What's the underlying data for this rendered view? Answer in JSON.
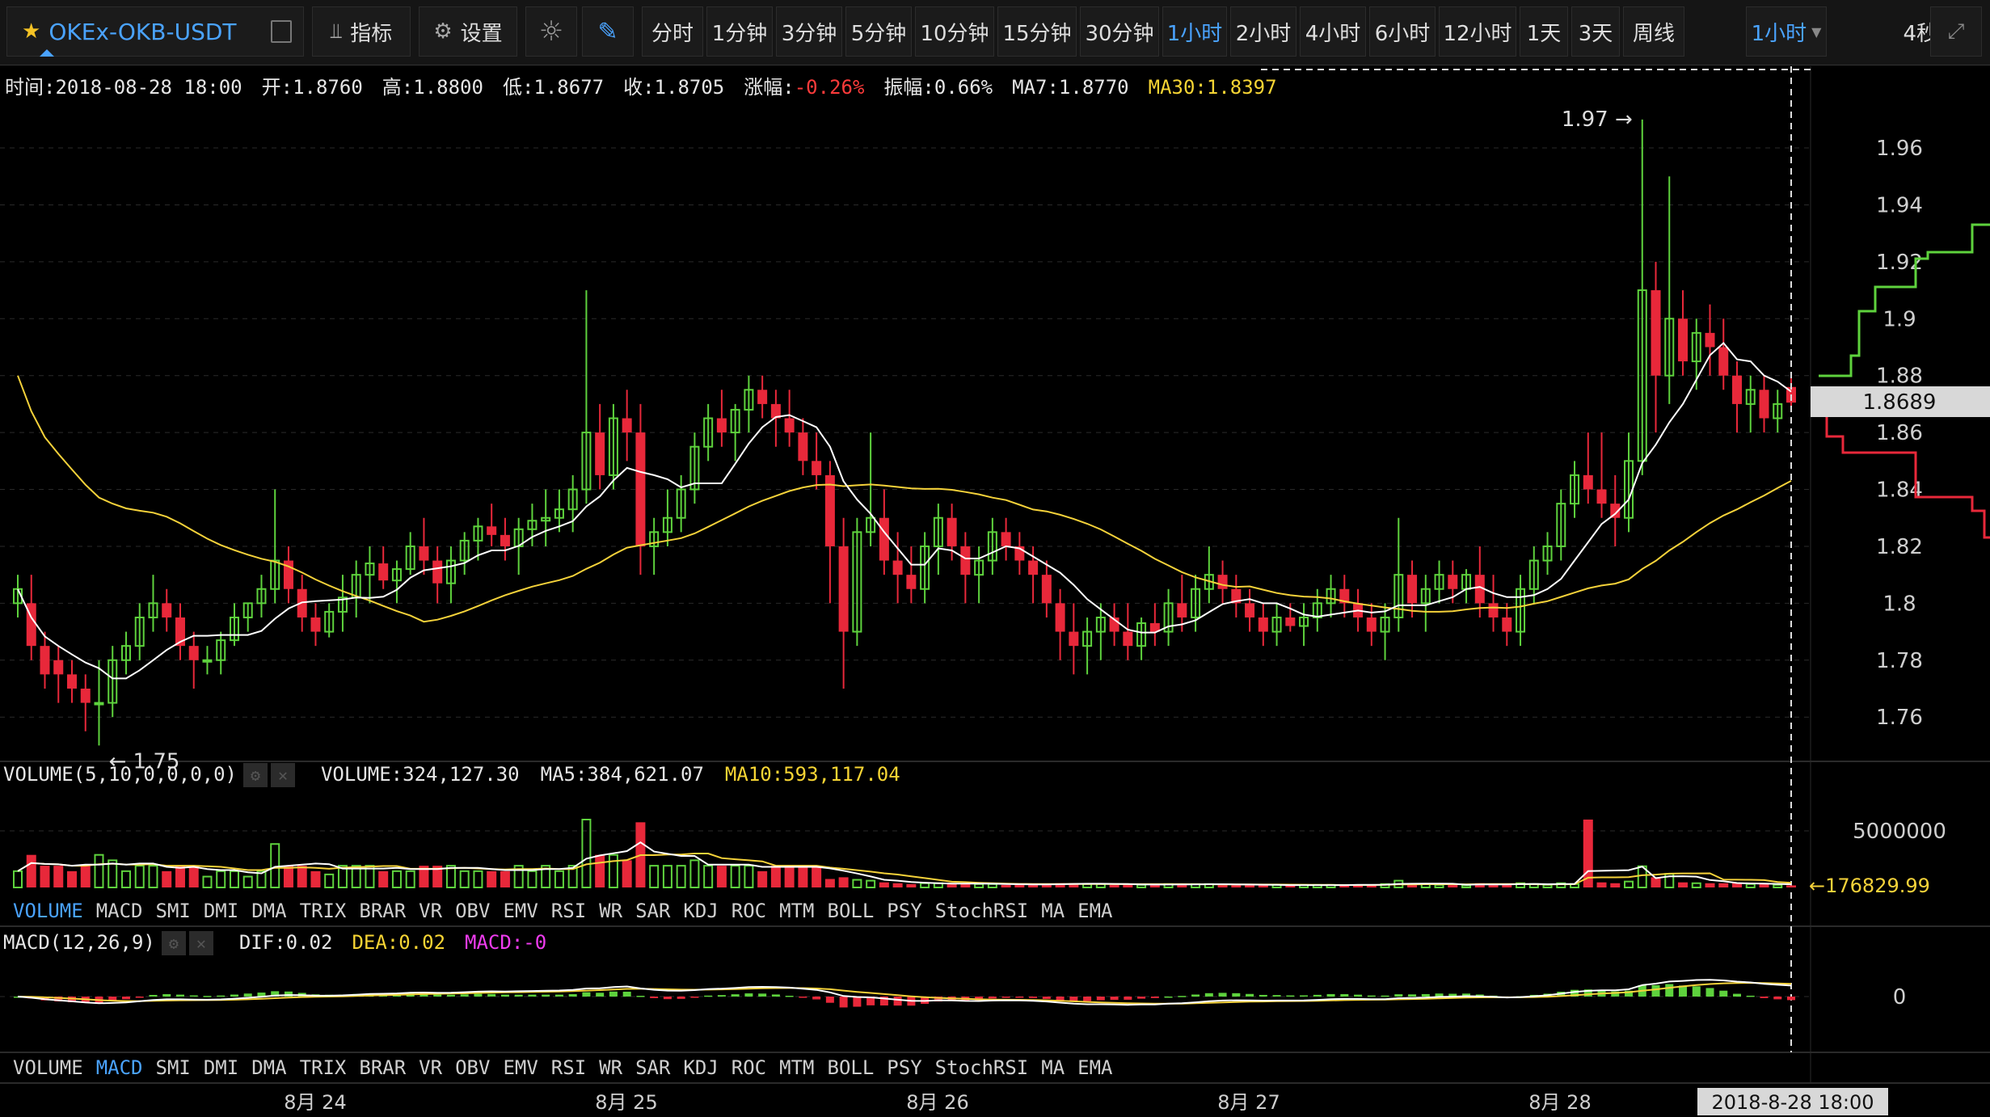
{
  "toolbar": {
    "pair": "OKEx-OKB-USDT",
    "indicators_label": "指标",
    "settings_label": "设置",
    "timeframes": [
      "分时",
      "1分钟",
      "3分钟",
      "5分钟",
      "10分钟",
      "15分钟",
      "30分钟",
      "1小时",
      "2小时",
      "4小时",
      "6小时",
      "12小时",
      "1天",
      "3天",
      "周线"
    ],
    "active_timeframe": "1小时",
    "dropdown": "1小时",
    "refresh": "4秒"
  },
  "infobar": {
    "time": "时间:2018-08-28 18:00",
    "open": "开:1.8760",
    "high": "高:1.8800",
    "low": "低:1.8677",
    "close": "收:1.8705",
    "change_label": "涨幅:",
    "change": "-0.26%",
    "amplitude": "振幅:0.66%",
    "ma7": "MA7:1.8770",
    "ma30": "MA30:1.8397"
  },
  "volume_panel": {
    "title": "VOLUME(5,10,0,0,0,0)",
    "volume": "VOLUME:324,127.30",
    "ma5": "MA5:384,621.07",
    "ma10": "MA10:593,117.04",
    "axis_label": "5000000",
    "last_marker": "←176829.99"
  },
  "macd_panel": {
    "title": "MACD(12,26,9)",
    "dif": "DIF:0.02",
    "dea": "DEA:0.02",
    "macd": "MACD:-0",
    "axis_label": "0"
  },
  "tabs": [
    "VOLUME",
    "MACD",
    "SMI",
    "DMI",
    "DMA",
    "TRIX",
    "BRAR",
    "VR",
    "OBV",
    "EMV",
    "RSI",
    "WR",
    "SAR",
    "KDJ",
    "ROC",
    "MTM",
    "BOLL",
    "PSY",
    "StochRSI",
    "MA",
    "EMA"
  ],
  "tabs_active_1": "VOLUME",
  "tabs_active_2": "MACD",
  "x_labels": [
    "8月 24",
    "8月 25",
    "8月 26",
    "8月 27",
    "8月 28"
  ],
  "crosshair_time": "2018-8-28 18:00",
  "current_price": "1.8689",
  "colors": {
    "up": "#5ed23d",
    "down": "#e8283a",
    "ma7": "#ffffff",
    "ma30": "#f5d23a",
    "accent": "#4aa3ff"
  },
  "chart_data": {
    "type": "candlestick",
    "title": "OKEx-OKB-USDT",
    "interval": "1小时",
    "y_ticks": [
      1.76,
      1.78,
      1.8,
      1.82,
      1.84,
      1.86,
      1.88,
      1.9,
      1.92,
      1.94,
      1.96
    ],
    "ylim": [
      1.745,
      1.985
    ],
    "max_label": "1.97 →",
    "min_label": "← 1.75",
    "grid": true,
    "candles_ohlc": [
      [
        1.8,
        1.81,
        1.795,
        1.805
      ],
      [
        1.8,
        1.81,
        1.78,
        1.785
      ],
      [
        1.785,
        1.79,
        1.77,
        1.775
      ],
      [
        1.78,
        1.785,
        1.765,
        1.775
      ],
      [
        1.775,
        1.78,
        1.765,
        1.77
      ],
      [
        1.77,
        1.775,
        1.755,
        1.765
      ],
      [
        1.765,
        1.78,
        1.75,
        1.765
      ],
      [
        1.765,
        1.785,
        1.76,
        1.78
      ],
      [
        1.78,
        1.79,
        1.775,
        1.785
      ],
      [
        1.785,
        1.8,
        1.78,
        1.795
      ],
      [
        1.795,
        1.81,
        1.79,
        1.8
      ],
      [
        1.8,
        1.805,
        1.79,
        1.795
      ],
      [
        1.795,
        1.8,
        1.78,
        1.785
      ],
      [
        1.785,
        1.79,
        1.77,
        1.78
      ],
      [
        1.78,
        1.785,
        1.775,
        1.78
      ],
      [
        1.78,
        1.79,
        1.775,
        1.787
      ],
      [
        1.787,
        1.8,
        1.785,
        1.795
      ],
      [
        1.795,
        1.8,
        1.79,
        1.8
      ],
      [
        1.8,
        1.81,
        1.795,
        1.805
      ],
      [
        1.805,
        1.84,
        1.8,
        1.815
      ],
      [
        1.815,
        1.82,
        1.8,
        1.805
      ],
      [
        1.805,
        1.81,
        1.79,
        1.795
      ],
      [
        1.795,
        1.8,
        1.785,
        1.79
      ],
      [
        1.79,
        1.8,
        1.788,
        1.797
      ],
      [
        1.797,
        1.81,
        1.79,
        1.802
      ],
      [
        1.802,
        1.815,
        1.795,
        1.81
      ],
      [
        1.81,
        1.82,
        1.8,
        1.814
      ],
      [
        1.814,
        1.82,
        1.805,
        1.808
      ],
      [
        1.808,
        1.815,
        1.8,
        1.812
      ],
      [
        1.812,
        1.825,
        1.81,
        1.82
      ],
      [
        1.82,
        1.83,
        1.81,
        1.815
      ],
      [
        1.815,
        1.82,
        1.8,
        1.807
      ],
      [
        1.807,
        1.82,
        1.8,
        1.815
      ],
      [
        1.815,
        1.825,
        1.81,
        1.822
      ],
      [
        1.822,
        1.83,
        1.815,
        1.827
      ],
      [
        1.827,
        1.835,
        1.82,
        1.824
      ],
      [
        1.824,
        1.83,
        1.815,
        1.82
      ],
      [
        1.82,
        1.83,
        1.81,
        1.826
      ],
      [
        1.826,
        1.835,
        1.82,
        1.829
      ],
      [
        1.829,
        1.84,
        1.82,
        1.83
      ],
      [
        1.83,
        1.84,
        1.825,
        1.833
      ],
      [
        1.833,
        1.845,
        1.825,
        1.84
      ],
      [
        1.84,
        1.91,
        1.835,
        1.86
      ],
      [
        1.86,
        1.87,
        1.84,
        1.845
      ],
      [
        1.845,
        1.87,
        1.84,
        1.865
      ],
      [
        1.865,
        1.875,
        1.85,
        1.86
      ],
      [
        1.86,
        1.87,
        1.81,
        1.82
      ],
      [
        1.82,
        1.83,
        1.81,
        1.825
      ],
      [
        1.825,
        1.84,
        1.82,
        1.83
      ],
      [
        1.83,
        1.845,
        1.825,
        1.84
      ],
      [
        1.84,
        1.86,
        1.835,
        1.855
      ],
      [
        1.855,
        1.87,
        1.85,
        1.865
      ],
      [
        1.865,
        1.875,
        1.855,
        1.86
      ],
      [
        1.86,
        1.87,
        1.85,
        1.868
      ],
      [
        1.868,
        1.88,
        1.86,
        1.875
      ],
      [
        1.875,
        1.88,
        1.865,
        1.87
      ],
      [
        1.87,
        1.875,
        1.855,
        1.865
      ],
      [
        1.865,
        1.875,
        1.855,
        1.86
      ],
      [
        1.86,
        1.865,
        1.845,
        1.85
      ],
      [
        1.85,
        1.86,
        1.84,
        1.845
      ],
      [
        1.845,
        1.85,
        1.8,
        1.82
      ],
      [
        1.82,
        1.83,
        1.77,
        1.79
      ],
      [
        1.79,
        1.83,
        1.785,
        1.825
      ],
      [
        1.825,
        1.86,
        1.82,
        1.83
      ],
      [
        1.83,
        1.84,
        1.81,
        1.815
      ],
      [
        1.815,
        1.825,
        1.8,
        1.81
      ],
      [
        1.81,
        1.82,
        1.8,
        1.805
      ],
      [
        1.805,
        1.825,
        1.8,
        1.82
      ],
      [
        1.82,
        1.835,
        1.81,
        1.83
      ],
      [
        1.83,
        1.835,
        1.815,
        1.82
      ],
      [
        1.82,
        1.825,
        1.8,
        1.81
      ],
      [
        1.81,
        1.82,
        1.8,
        1.815
      ],
      [
        1.815,
        1.83,
        1.81,
        1.825
      ],
      [
        1.825,
        1.83,
        1.815,
        1.82
      ],
      [
        1.82,
        1.825,
        1.81,
        1.815
      ],
      [
        1.815,
        1.82,
        1.8,
        1.81
      ],
      [
        1.81,
        1.815,
        1.795,
        1.8
      ],
      [
        1.8,
        1.805,
        1.78,
        1.79
      ],
      [
        1.79,
        1.8,
        1.775,
        1.785
      ],
      [
        1.785,
        1.795,
        1.775,
        1.79
      ],
      [
        1.79,
        1.8,
        1.78,
        1.795
      ],
      [
        1.795,
        1.8,
        1.785,
        1.79
      ],
      [
        1.79,
        1.8,
        1.78,
        1.785
      ],
      [
        1.785,
        1.795,
        1.78,
        1.793
      ],
      [
        1.793,
        1.8,
        1.785,
        1.79
      ],
      [
        1.79,
        1.805,
        1.785,
        1.8
      ],
      [
        1.8,
        1.81,
        1.79,
        1.795
      ],
      [
        1.795,
        1.81,
        1.79,
        1.805
      ],
      [
        1.805,
        1.82,
        1.8,
        1.81
      ],
      [
        1.81,
        1.815,
        1.8,
        1.805
      ],
      [
        1.805,
        1.81,
        1.795,
        1.8
      ],
      [
        1.8,
        1.805,
        1.79,
        1.795
      ],
      [
        1.795,
        1.8,
        1.785,
        1.79
      ],
      [
        1.79,
        1.8,
        1.785,
        1.795
      ],
      [
        1.795,
        1.8,
        1.79,
        1.792
      ],
      [
        1.792,
        1.8,
        1.785,
        1.795
      ],
      [
        1.795,
        1.805,
        1.79,
        1.8
      ],
      [
        1.8,
        1.81,
        1.795,
        1.805
      ],
      [
        1.805,
        1.81,
        1.795,
        1.8
      ],
      [
        1.8,
        1.805,
        1.79,
        1.795
      ],
      [
        1.795,
        1.8,
        1.785,
        1.79
      ],
      [
        1.79,
        1.8,
        1.78,
        1.795
      ],
      [
        1.795,
        1.83,
        1.79,
        1.81
      ],
      [
        1.81,
        1.815,
        1.795,
        1.8
      ],
      [
        1.8,
        1.81,
        1.79,
        1.805
      ],
      [
        1.805,
        1.815,
        1.8,
        1.81
      ],
      [
        1.81,
        1.815,
        1.8,
        1.805
      ],
      [
        1.805,
        1.812,
        1.8,
        1.81
      ],
      [
        1.81,
        1.82,
        1.795,
        1.8
      ],
      [
        1.8,
        1.81,
        1.79,
        1.795
      ],
      [
        1.795,
        1.8,
        1.785,
        1.79
      ],
      [
        1.79,
        1.81,
        1.785,
        1.805
      ],
      [
        1.805,
        1.82,
        1.8,
        1.815
      ],
      [
        1.815,
        1.825,
        1.81,
        1.82
      ],
      [
        1.82,
        1.84,
        1.815,
        1.835
      ],
      [
        1.835,
        1.85,
        1.83,
        1.845
      ],
      [
        1.845,
        1.86,
        1.835,
        1.84
      ],
      [
        1.84,
        1.86,
        1.83,
        1.835
      ],
      [
        1.835,
        1.845,
        1.82,
        1.83
      ],
      [
        1.83,
        1.86,
        1.825,
        1.85
      ],
      [
        1.85,
        1.97,
        1.845,
        1.91
      ],
      [
        1.91,
        1.92,
        1.86,
        1.88
      ],
      [
        1.88,
        1.95,
        1.87,
        1.9
      ],
      [
        1.9,
        1.91,
        1.88,
        1.885
      ],
      [
        1.885,
        1.9,
        1.875,
        1.895
      ],
      [
        1.895,
        1.905,
        1.88,
        1.89
      ],
      [
        1.89,
        1.9,
        1.875,
        1.88
      ],
      [
        1.88,
        1.885,
        1.86,
        1.87
      ],
      [
        1.87,
        1.88,
        1.86,
        1.875
      ],
      [
        1.875,
        1.88,
        1.86,
        1.865
      ],
      [
        1.865,
        1.875,
        1.86,
        1.87
      ],
      [
        1.876,
        1.88,
        1.8677,
        1.8705
      ]
    ],
    "volume_ylim": [
      0,
      7000000
    ],
    "macd_ylim": [
      -0.06,
      0.06
    ]
  }
}
